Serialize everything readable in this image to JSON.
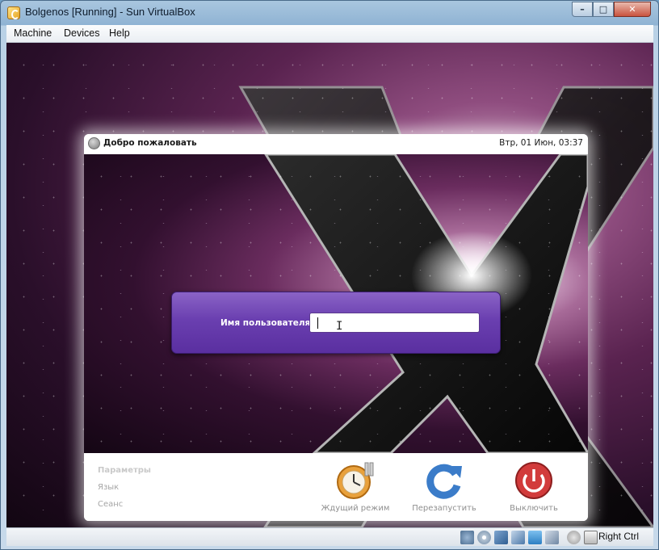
{
  "window": {
    "title": "Bolgenos [Running] - Sun VirtualBox",
    "controls": {
      "minimize": "–",
      "maximize": "□",
      "close": "✕"
    }
  },
  "menubar": {
    "items": [
      "Machine",
      "Devices",
      "Help"
    ]
  },
  "guest": {
    "header": {
      "title": "Добро пожаловать",
      "clock": "Втр, 01 Июн, 03:37"
    },
    "login": {
      "label": "Имя пользователя:",
      "value": ""
    },
    "side_links": [
      "Параметры",
      "Язык",
      "Сеанс"
    ],
    "actions": [
      {
        "label": "Ждущий режим",
        "icon": "suspend-clock-icon",
        "color": "#e9a13b"
      },
      {
        "label": "Перезапустить",
        "icon": "restart-arrow-icon",
        "color": "#3b7cc9"
      },
      {
        "label": "Выключить",
        "icon": "power-off-icon",
        "color": "#d23b3b"
      }
    ]
  },
  "statusbar": {
    "icons": [
      "hard-disk-icon",
      "optical-drive-icon",
      "network-icon",
      "usb-icon",
      "shared-folders-icon",
      "virtualization-icon",
      "mouse-integration-icon",
      "host-key-icon"
    ],
    "host_key": "Right Ctrl"
  }
}
